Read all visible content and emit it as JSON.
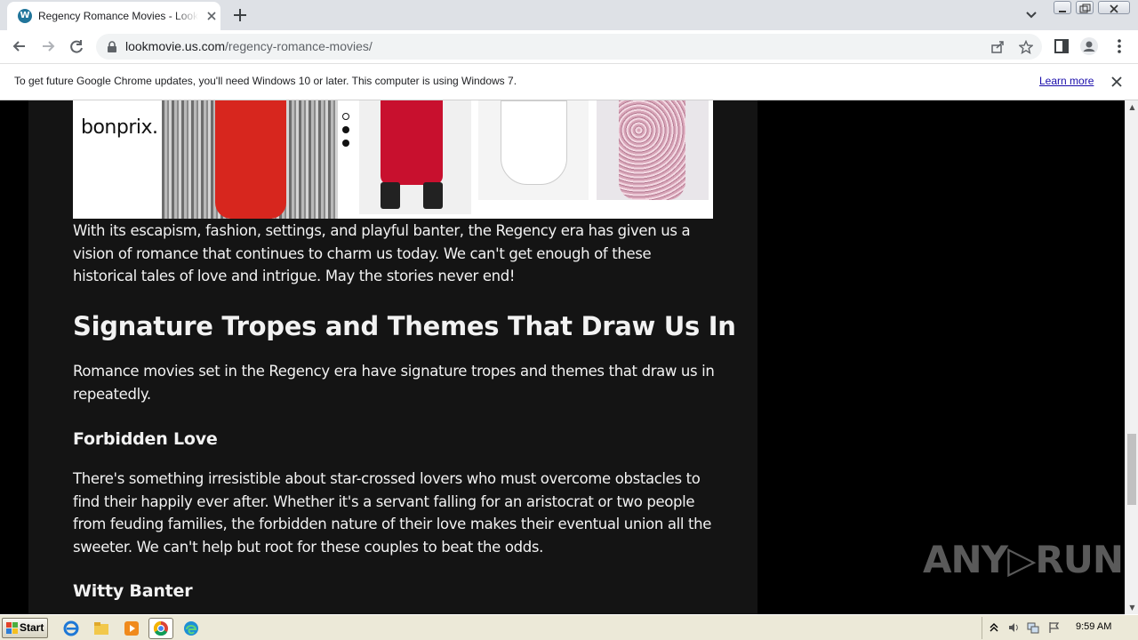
{
  "browser": {
    "tab_title": "Regency Romance Movies - Lookmovie",
    "url_host": "lookmovie.us.com",
    "url_path": "/regency-romance-movies/"
  },
  "infobar": {
    "message": "To get future Google Chrome updates, you'll need Windows 10 or later. This computer is using Windows 7.",
    "link": "Learn more"
  },
  "ad": {
    "brand": "bonprix."
  },
  "article": {
    "intro_paragraph": "With its escapism, fashion, settings, and playful banter, the Regency era has given us a vision of romance that continues to charm us today. We can't get enough of these historical tales of love and intrigue. May the stories never end!",
    "section_heading": "Signature Tropes and Themes That Draw Us In",
    "section_paragraph": "Romance movies set in the Regency era have signature tropes and themes that draw us in repeatedly.",
    "sub1_heading": "Forbidden Love",
    "sub1_paragraph": "There's something irresistible about star-crossed lovers who must overcome obstacles to find their happily ever after. Whether it's a servant falling for an aristocrat or two people from feuding families, the forbidden nature of their love makes their eventual union all the sweeter. We can't help but root for these couples to beat the odds.",
    "sub2_heading": "Witty Banter"
  },
  "watermark": "ANY▷RUN",
  "taskbar": {
    "start_label": "Start",
    "clock": "9:59 AM"
  },
  "colors": {
    "article_bg": "#141414",
    "page_bg": "#000000",
    "text": "#f2f2f2",
    "link": "#1a0dab",
    "tab_strip": "#dee1e6"
  }
}
